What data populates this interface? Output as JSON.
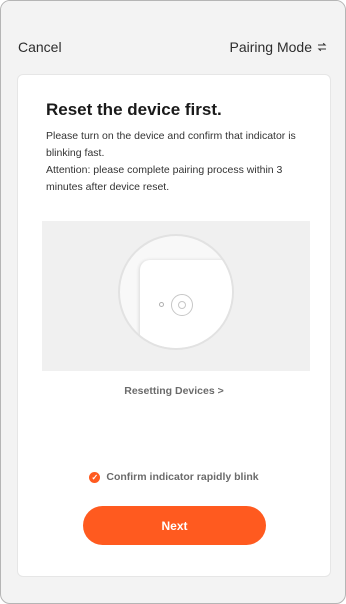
{
  "header": {
    "cancel_label": "Cancel",
    "mode_label": "Pairing Mode"
  },
  "content": {
    "title": "Reset the device first.",
    "paragraph1": "Please turn on the device and confirm that indicator is blinking fast.",
    "paragraph2": "Attention: please complete pairing process within 3 minutes after device reset."
  },
  "links": {
    "resetting": "Resetting Devices >"
  },
  "confirm": {
    "label": "Confirm indicator rapidly blink",
    "checked": true
  },
  "actions": {
    "next_label": "Next"
  },
  "colors": {
    "accent": "#ff5a1f",
    "background": "#f3f3f3",
    "card": "#ffffff"
  }
}
